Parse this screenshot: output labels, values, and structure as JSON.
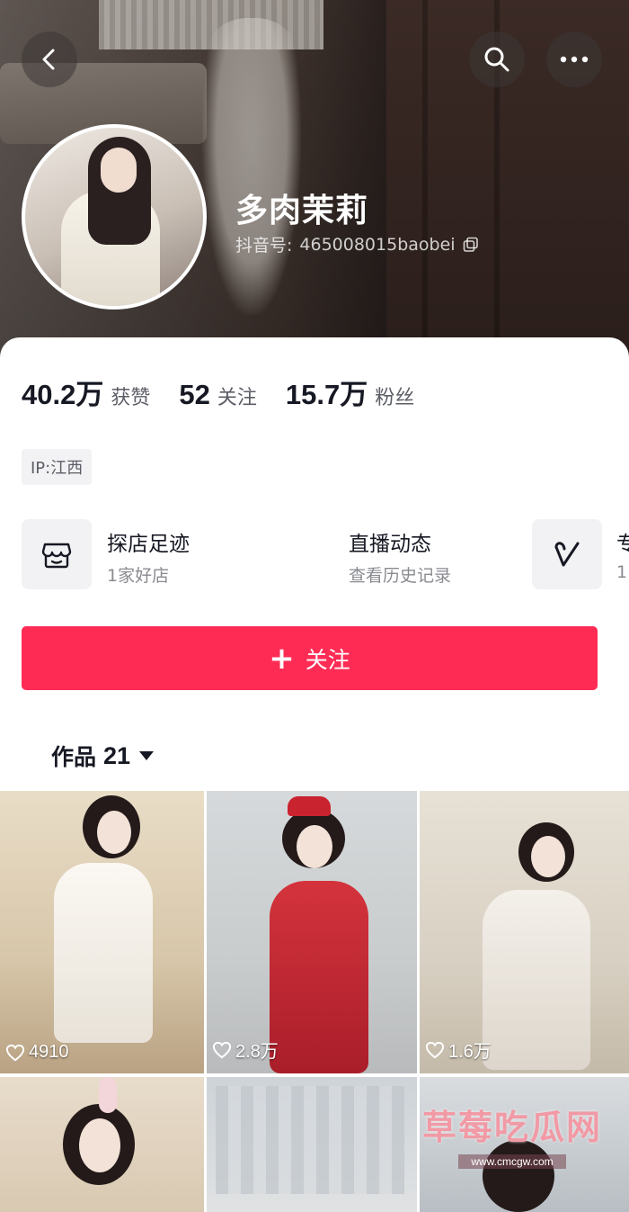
{
  "header": {
    "display_name": "多肉茉莉",
    "douyin_id_label": "抖音号:",
    "douyin_id_value": "465008015baobei",
    "icons": {
      "back": "chevron-left-icon",
      "search": "search-icon",
      "more": "more-dots-icon",
      "copy": "copy-icon"
    }
  },
  "stats": [
    {
      "value": "40.2万",
      "label": "获赞"
    },
    {
      "value": "52",
      "label": "关注"
    },
    {
      "value": "15.7万",
      "label": "粉丝"
    }
  ],
  "ip_tag": "IP:江西",
  "features": [
    {
      "title": "探店足迹",
      "subtitle": "1家好店",
      "icon": "store-icon"
    },
    {
      "title": "直播动态",
      "subtitle": "查看历史记录",
      "icon": ""
    },
    {
      "title": "专",
      "subtitle": "1",
      "icon": "heart-outline-icon"
    }
  ],
  "follow_button": {
    "label": "关注"
  },
  "works_tab": {
    "label": "作品",
    "count": "21"
  },
  "tiles": [
    {
      "likes": "4910"
    },
    {
      "likes": "2.8万"
    },
    {
      "likes": "1.6万"
    },
    {
      "likes": ""
    },
    {
      "likes": ""
    },
    {
      "likes": ""
    }
  ],
  "watermark": {
    "title": "草莓吃瓜网",
    "url": "www.cmcgw.com"
  },
  "colors": {
    "accent": "#fe2c55",
    "text_primary": "#161823",
    "text_secondary": "#5c5e66"
  }
}
